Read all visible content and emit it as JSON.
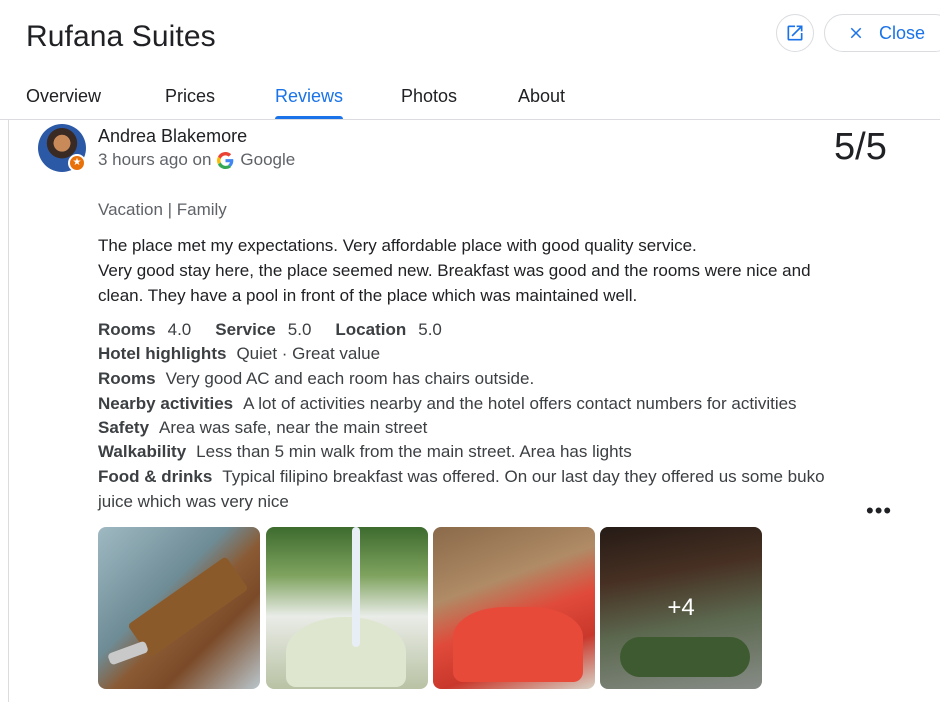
{
  "header": {
    "title": "Rufana Suites",
    "close_label": "Close"
  },
  "tabs": [
    {
      "label": "Overview"
    },
    {
      "label": "Prices"
    },
    {
      "label": "Reviews",
      "active": true
    },
    {
      "label": "Photos"
    },
    {
      "label": "About"
    }
  ],
  "review": {
    "author": "Andrea Blakemore",
    "time": "3 hours ago on",
    "source": "Google",
    "score": "5/5",
    "trip_type": "Vacation | Family",
    "text_lines": [
      "The place met my expectations. Very affordable place with good quality service.",
      "Very good stay here, the place seemed new. Breakfast was good and the rooms were nice and",
      "clean. They have a pool in front of the place which was maintained well."
    ],
    "ratings": [
      {
        "label": "Rooms",
        "value": "4.0"
      },
      {
        "label": "Service",
        "value": "5.0"
      },
      {
        "label": "Location",
        "value": "5.0"
      }
    ],
    "details": [
      {
        "label": "Hotel highlights",
        "value": "Quiet · Great value"
      },
      {
        "label": "Rooms",
        "value": "Very good AC and each room has chairs outside."
      },
      {
        "label": "Nearby activities",
        "value": "A lot of activities nearby and the hotel offers contact numbers for activities"
      },
      {
        "label": "Safety",
        "value": "Area was safe, near the main street"
      },
      {
        "label": "Walkability",
        "value": "Less than 5 min walk from the main street. Area has lights"
      },
      {
        "label": "Food & drinks",
        "value": "Typical filipino breakfast was offered. On our last day they offered us some buko"
      }
    ],
    "details_continued": "juice which was very nice",
    "more_photos": "+4"
  },
  "colors": {
    "accent": "#1a73e8",
    "text_primary": "#202124",
    "text_secondary": "#5f6368",
    "badge": "#e8710a"
  },
  "icons": {
    "open_external": "open-in-new-icon",
    "close": "close-icon",
    "source": "google-logo-icon",
    "more": "more-horizontal-icon"
  }
}
